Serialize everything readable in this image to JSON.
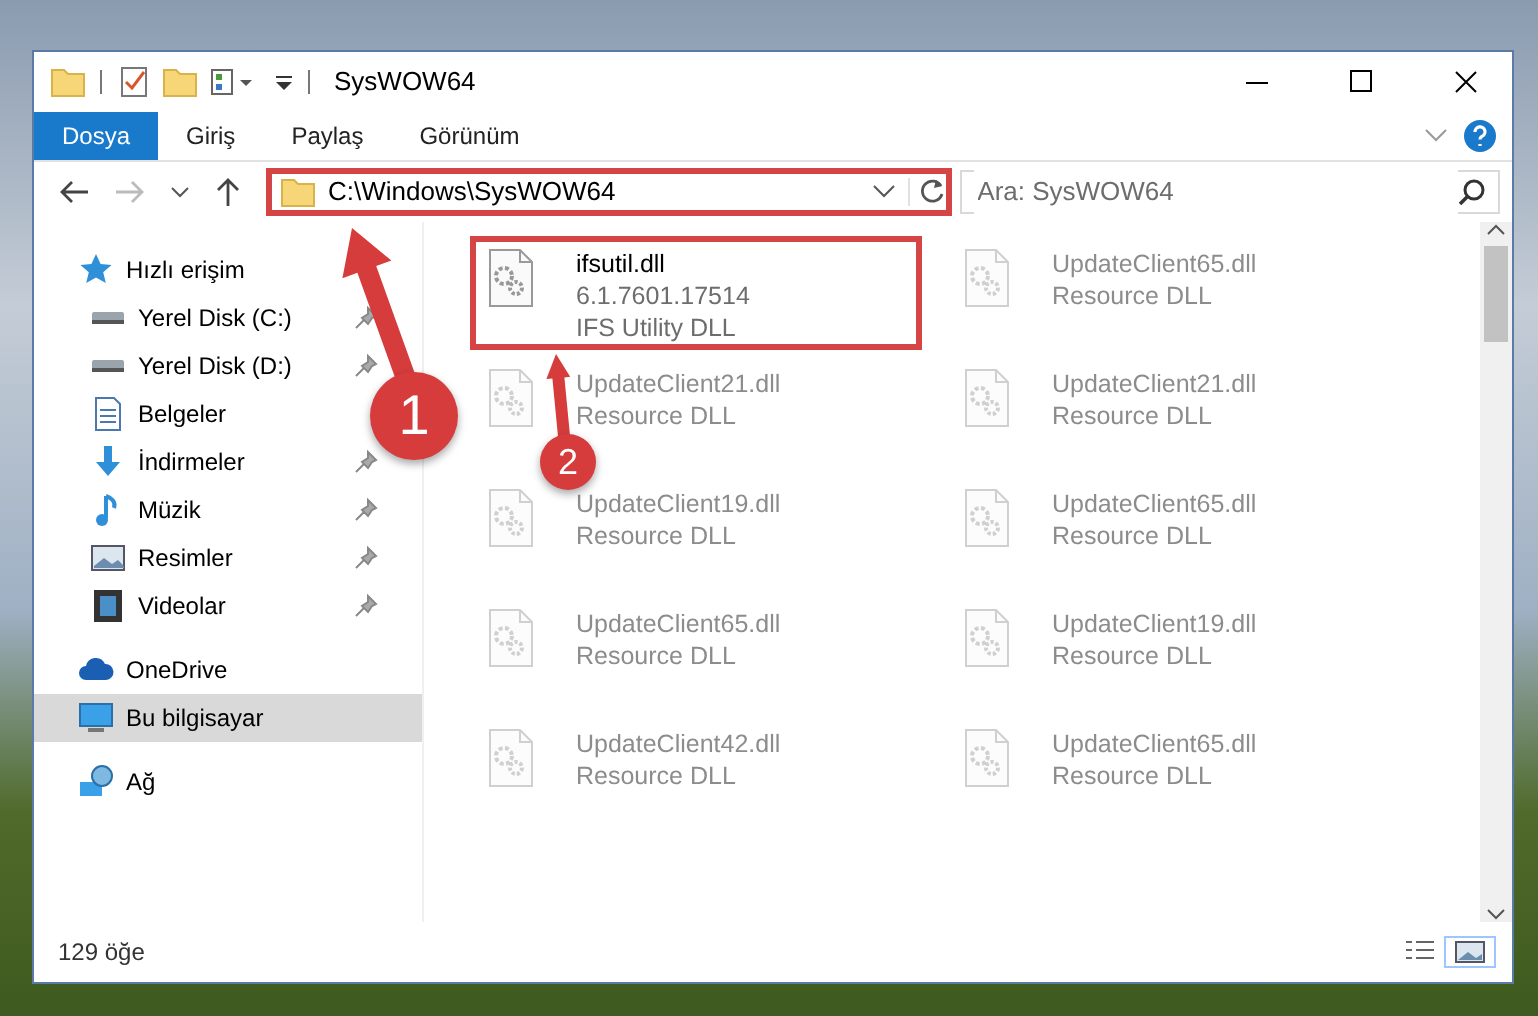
{
  "window": {
    "title": "SysWOW64"
  },
  "ribbon_tabs": [
    {
      "label": "Dosya",
      "selected": true
    },
    {
      "label": "Giriş",
      "selected": false
    },
    {
      "label": "Paylaş",
      "selected": false
    },
    {
      "label": "Görünüm",
      "selected": false
    }
  ],
  "address": {
    "path": "C:\\Windows\\SysWOW64",
    "highlighted": true
  },
  "search": {
    "placeholder": "Ara: SysWOW64"
  },
  "sidebar": {
    "items": [
      {
        "label": "Hızlı erişim",
        "kind": "star",
        "selected": false,
        "children": [
          {
            "label": "Yerel Disk (C:)",
            "kind": "drive",
            "pinned": true
          },
          {
            "label": "Yerel Disk (D:)",
            "kind": "drive",
            "pinned": true
          },
          {
            "label": "Belgeler",
            "kind": "documents"
          },
          {
            "label": "İndirmeler",
            "kind": "download",
            "pinned": true
          },
          {
            "label": "Müzik",
            "kind": "music",
            "pinned": true
          },
          {
            "label": "Resimler",
            "kind": "pictures",
            "pinned": true
          },
          {
            "label": "Videolar",
            "kind": "videos",
            "pinned": true
          }
        ]
      },
      {
        "label": "OneDrive",
        "kind": "cloud",
        "selected": false
      },
      {
        "label": "Bu bilgisayar",
        "kind": "computer",
        "selected": true
      },
      {
        "label": "Ağ",
        "kind": "network",
        "selected": false
      }
    ]
  },
  "files": [
    {
      "name": "ifsutil.dll",
      "details": [
        "6.1.7601.17514",
        "IFS Utility DLL"
      ],
      "faded": false,
      "highlighted": true
    },
    {
      "name": "UpdateClient65.dll",
      "details": [
        "Resource DLL"
      ],
      "faded": true
    },
    {
      "name": "UpdateClient21.dll",
      "details": [
        "Resource DLL"
      ],
      "faded": true
    },
    {
      "name": "UpdateClient21.dll",
      "details": [
        "Resource DLL"
      ],
      "faded": true
    },
    {
      "name": "UpdateClient19.dll",
      "details": [
        "Resource DLL"
      ],
      "faded": true
    },
    {
      "name": "UpdateClient65.dll",
      "details": [
        "Resource DLL"
      ],
      "faded": true
    },
    {
      "name": "UpdateClient65.dll",
      "details": [
        "Resource DLL"
      ],
      "faded": true
    },
    {
      "name": "UpdateClient19.dll",
      "details": [
        "Resource DLL"
      ],
      "faded": true
    },
    {
      "name": "UpdateClient42.dll",
      "details": [
        "Resource DLL"
      ],
      "faded": true
    },
    {
      "name": "UpdateClient65.dll",
      "details": [
        "Resource DLL"
      ],
      "faded": true
    }
  ],
  "callouts": [
    {
      "number": "1"
    },
    {
      "number": "2"
    }
  ],
  "status_bar": {
    "count": "129 öğe"
  }
}
